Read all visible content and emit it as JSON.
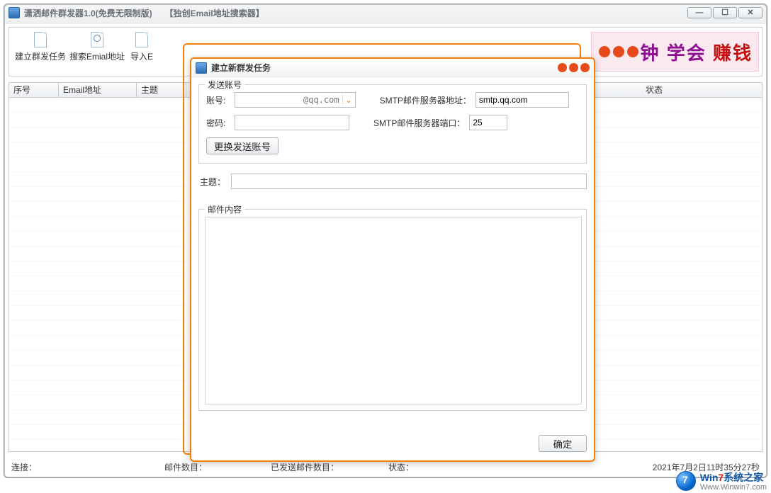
{
  "main": {
    "title": "潇洒邮件群发器1.0(免费无限制版)　　【独创Email地址搜索器】",
    "toolbar": {
      "create": "建立群发任务",
      "search": "搜索Emial地址",
      "import": "导入E"
    },
    "promo": {
      "pre": "钟",
      "t1": "学会",
      "t2": "赚钱"
    },
    "grid": {
      "col1": "序号",
      "col2": "Email地址",
      "col3": "主题",
      "col_last": "状态"
    },
    "status": {
      "conn": "连接：",
      "mails": "邮件数目：",
      "sent": "已发送邮件数目：",
      "state": "状态：",
      "time": "2021年7月2日11时35分27秒"
    }
  },
  "dialog": {
    "title": "建立新群发任务",
    "acct_legend": "发送账号",
    "acct_label": "账号:",
    "acct_suffix": "@qq.com",
    "acct_value": "",
    "pwd_label": "密码:",
    "pwd_value": "",
    "smtp_addr_label": "SMTP邮件服务器地址：",
    "smtp_addr_value": "smtp.qq.com",
    "smtp_port_label": "SMTP邮件服务器端口：",
    "smtp_port_value": "25",
    "change_acct_btn": "更换发送账号",
    "subject_label": "主题：",
    "subject_value": "",
    "content_legend": "邮件内容",
    "content_value": "",
    "ok": "确定"
  },
  "watermark": {
    "brand_a": "Win",
    "brand_b": "7",
    "brand_c": "系统之家",
    "url": "Www.Winwin7.com"
  }
}
